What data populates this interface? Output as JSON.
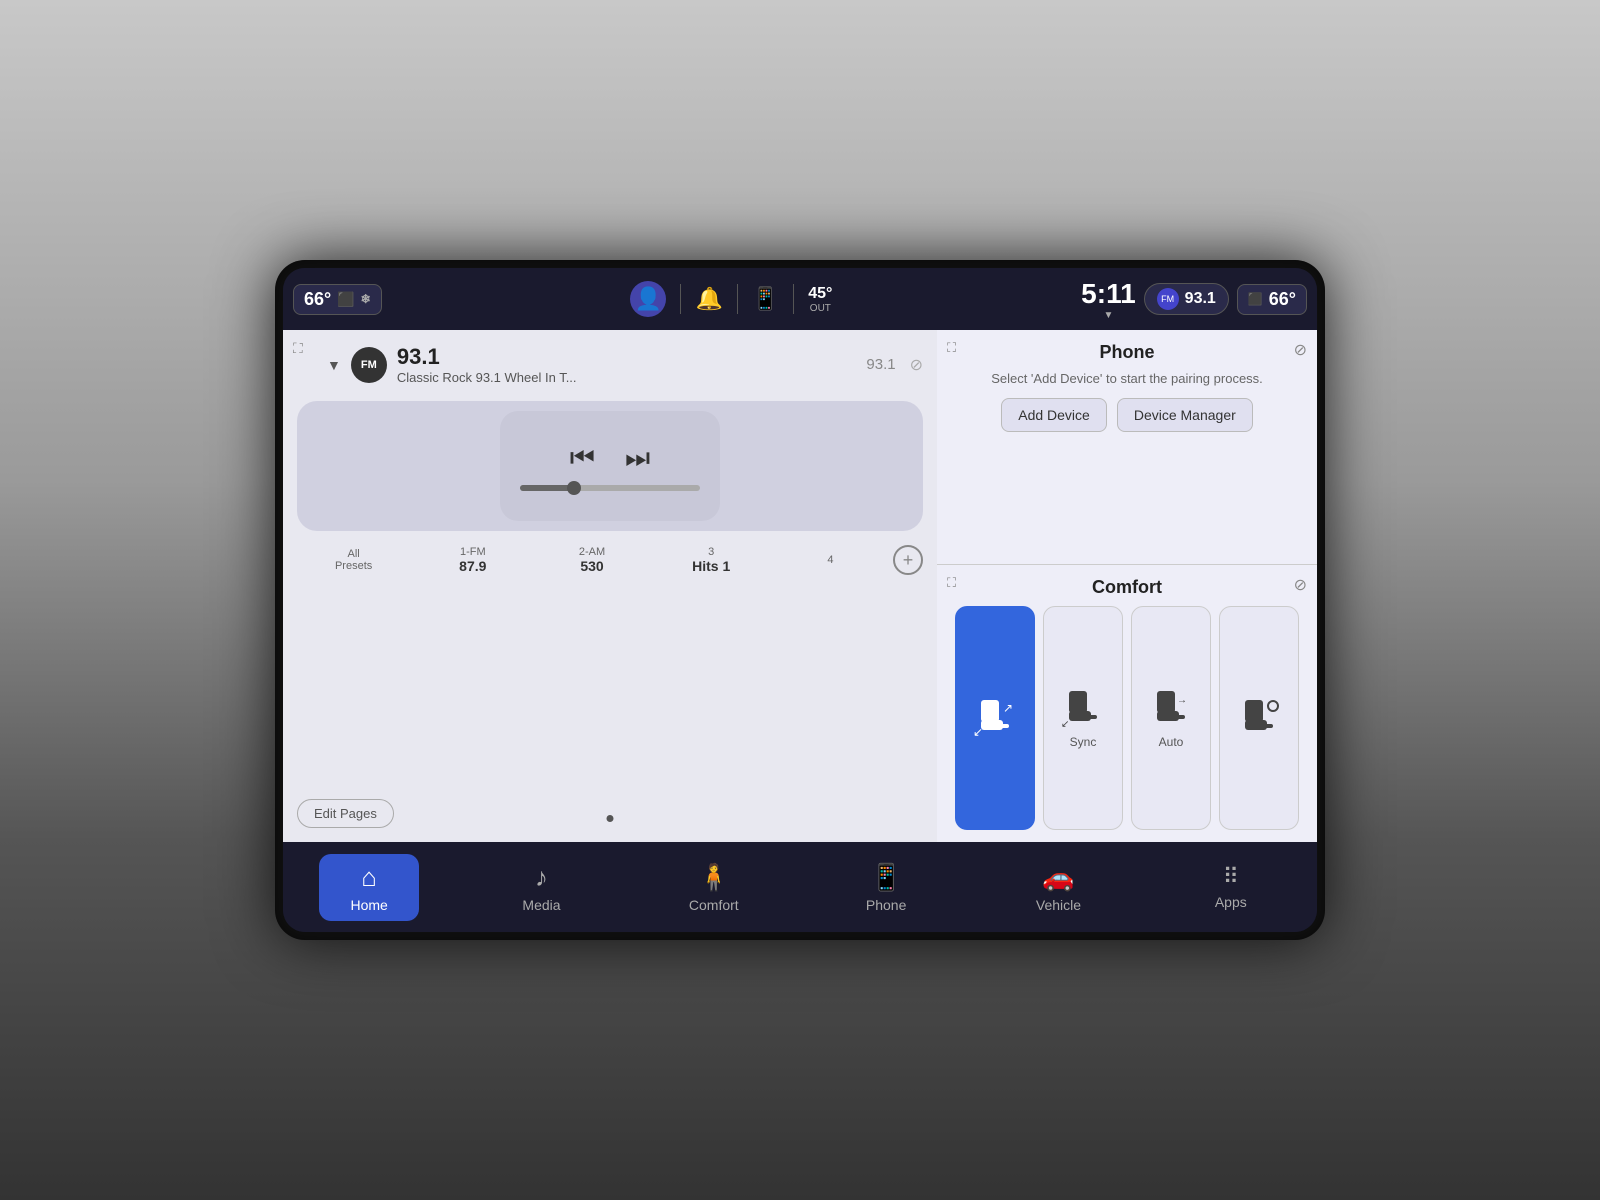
{
  "statusBar": {
    "tempLeft": "66°",
    "tempRight": "66°",
    "outsideTemp": "45°",
    "outsideTempLabel": "OUT",
    "time": "5:11",
    "radioFM": "FM",
    "radioFreq": "93.1",
    "icons": {
      "seat": "🪑",
      "notification": "🔔",
      "phone": "📱"
    }
  },
  "radio": {
    "badge": "FM",
    "frequency": "93.1",
    "station": "Classic Rock 93.1 Wheel In T...",
    "freqRight": "93.1",
    "presets": [
      {
        "label": "All\nPresets",
        "freq": ""
      },
      {
        "label": "1-FM",
        "freq": "87.9"
      },
      {
        "label": "2-AM",
        "freq": "530"
      },
      {
        "label": "3",
        "freq": "Hits 1"
      },
      {
        "label": "4",
        "freq": ""
      }
    ],
    "editPagesLabel": "Edit Pages"
  },
  "phone": {
    "title": "Phone",
    "subtitle": "Select 'Add Device' to start the pairing process.",
    "addDeviceLabel": "Add Device",
    "deviceManagerLabel": "Device Manager"
  },
  "comfort": {
    "title": "Comfort",
    "seats": [
      {
        "label": "",
        "active": true
      },
      {
        "label": "Sync",
        "active": false
      },
      {
        "label": "Auto",
        "active": false
      },
      {
        "label": "",
        "active": false
      }
    ]
  },
  "navBar": {
    "items": [
      {
        "id": "home",
        "label": "Home",
        "icon": "⌂",
        "active": true
      },
      {
        "id": "media",
        "label": "Media",
        "icon": "♪",
        "active": false
      },
      {
        "id": "comfort",
        "label": "Comfort",
        "icon": "👤",
        "active": false
      },
      {
        "id": "phone",
        "label": "Phone",
        "icon": "📱",
        "active": false
      },
      {
        "id": "vehicle",
        "label": "Vehicle",
        "icon": "🚗",
        "active": false
      },
      {
        "id": "apps",
        "label": "Apps",
        "icon": "⊞",
        "active": false
      }
    ]
  }
}
